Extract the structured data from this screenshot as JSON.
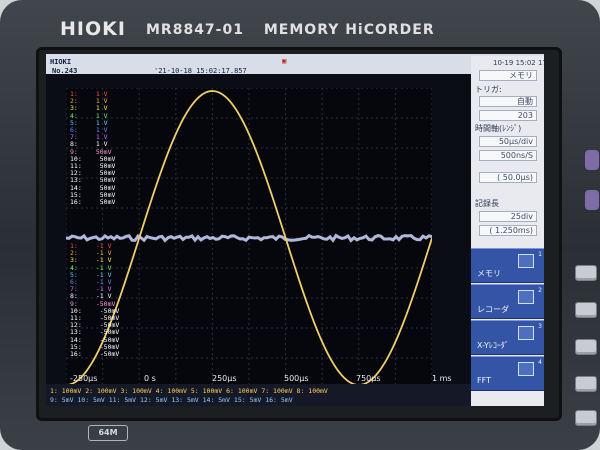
{
  "device": {
    "brand": "HIOKI",
    "model": "MR8847-01",
    "product_name": "MEMORY HiCORDER",
    "memory_label": "64M"
  },
  "screen": {
    "header": {
      "left_logo": "HIOKI",
      "record_no": "No.243",
      "timestamp": "'21-10-18 15:02:17.857"
    },
    "right_panel": {
      "datetime": "10-19 15:02 17",
      "mode_value": "メモリ",
      "trigger_label": "トリガ:",
      "trigger_value": "自動",
      "count_value": "203",
      "time_axis_label": "時間軸(ﾚﾝｼﾞ)",
      "time_per_div": "50μs/div",
      "sampling": "500ns/S",
      "record_time_label": "記録長",
      "record_length": "25div",
      "record_duration": "( 1.250ms)",
      "sub_range": "(   50.0μs)"
    },
    "function_buttons": [
      {
        "label": "メモリ",
        "number": "1"
      },
      {
        "label": "レコーダ",
        "number": "2"
      },
      {
        "label": "X-Yﾚｺｰﾀﾞ",
        "number": "3"
      },
      {
        "label": "FFT",
        "number": "4"
      }
    ],
    "channel_list_top": [
      {
        "ch": "1:",
        "range": "1 V"
      },
      {
        "ch": "2:",
        "range": "1 V"
      },
      {
        "ch": "3:",
        "range": "1 V"
      },
      {
        "ch": "4:",
        "range": "1 V"
      },
      {
        "ch": "5:",
        "range": "1 V"
      },
      {
        "ch": "6:",
        "range": "1 V"
      },
      {
        "ch": "7:",
        "range": "1 V"
      },
      {
        "ch": "8:",
        "range": "1 V"
      },
      {
        "ch": "9:",
        "range": "50mV"
      },
      {
        "ch": "10:",
        "range": "50mV"
      },
      {
        "ch": "11:",
        "range": "50mV"
      },
      {
        "ch": "12:",
        "range": "50mV"
      },
      {
        "ch": "13:",
        "range": "50mV"
      },
      {
        "ch": "14:",
        "range": "50mV"
      },
      {
        "ch": "15:",
        "range": "50mV"
      },
      {
        "ch": "16:",
        "range": "50mV"
      }
    ],
    "channel_list_bottom": [
      {
        "ch": "1:",
        "range": "-1 V"
      },
      {
        "ch": "2:",
        "range": "-1 V"
      },
      {
        "ch": "3:",
        "range": "-1 V"
      },
      {
        "ch": "4:",
        "range": "-1 V"
      },
      {
        "ch": "5:",
        "range": "-1 V"
      },
      {
        "ch": "6:",
        "range": "-1 V"
      },
      {
        "ch": "7:",
        "range": "-1 V"
      },
      {
        "ch": "8:",
        "range": "-1 V"
      },
      {
        "ch": "9:",
        "range": "-50mV"
      },
      {
        "ch": "10:",
        "range": "-50mV"
      },
      {
        "ch": "11:",
        "range": "-50mV"
      },
      {
        "ch": "12:",
        "range": "-50mV"
      },
      {
        "ch": "13:",
        "range": "-50mV"
      },
      {
        "ch": "14:",
        "range": "-50mV"
      },
      {
        "ch": "15:",
        "range": "-50mV"
      },
      {
        "ch": "16:",
        "range": "-50mV"
      }
    ],
    "x_axis_ticks": [
      "-250μs",
      "0 s",
      "250μs",
      "500μs",
      "750μs",
      "1 ms"
    ],
    "bottom_status": {
      "row1": "1:  100mV  2:  100mV  3:  100mV  4:  100mV  5:  100mV  6:  100mV  7:  100mV  8:  100mV",
      "row2": "9:  5mV 10:  5mV 11:  5mV 12:  5mV 13:  5mV 14:  5mV 15:  5mV 16:  5mV"
    },
    "colors": {
      "trace_sine": "#f0cf6a",
      "trace_flat": "#cfd6ff",
      "grid": "#2a2e3a"
    }
  },
  "waveform": {
    "sine": {
      "cycles_visible": 1,
      "peak_time_us": 250,
      "trough_time_us": 750,
      "zero_cross_time_us": 0
    },
    "flat_trace": "noisy baseline near center"
  }
}
